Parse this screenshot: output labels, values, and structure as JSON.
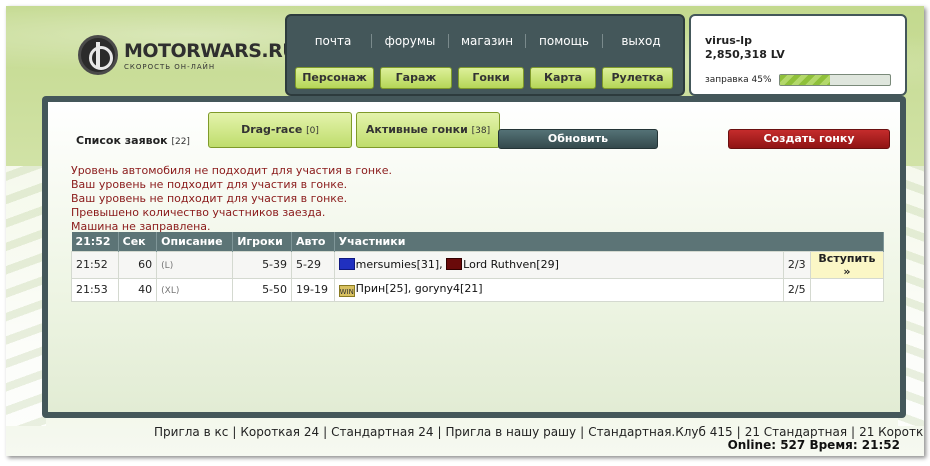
{
  "logo": {
    "title": "MOTORWARS.RU",
    "subtitle": "СКОРОСТЬ ОН-ЛАЙН"
  },
  "nav": {
    "links": [
      "почта",
      "форумы",
      "магазин",
      "помощь",
      "выход"
    ],
    "buttons": [
      "Персонаж",
      "Гараж",
      "Гонки",
      "Карта",
      "Рулетка"
    ]
  },
  "user": {
    "name": "virus-lp",
    "money": "2,850,318 LV",
    "fuel_label": "заправка 45%",
    "fuel_percent": 45
  },
  "race_list": {
    "title": "Список заявок",
    "count": "[22]",
    "tab_drag": "Drag-race",
    "tab_drag_count": "[0]",
    "tab_active": "Активные гонки",
    "tab_active_count": "[38]",
    "refresh": "Обновить",
    "create": "Создать гонку"
  },
  "messages": [
    "Уровень автомобиля не подходит для участия в гонке.",
    "Ваш уровень не подходит для участия в гонке.",
    "Ваш уровень не подходит для участия в гонке.",
    "Превышено количество участников заезда.",
    "Машина не заправлена."
  ],
  "table": {
    "headers": [
      "21:52",
      "Сек",
      "Описание",
      "Игроки",
      "Авто",
      "Участники"
    ],
    "rows": [
      {
        "time": "21:52",
        "sec": "60",
        "desc": "(L)",
        "players": "5-39",
        "auto": "5-29",
        "participants": [
          {
            "clan": "",
            "name": "mersumies[31]"
          },
          {
            "clan": "",
            "name": "Lord Ruthven[29]"
          }
        ],
        "sep": ",",
        "count": "2/3",
        "action": "Вступить »"
      },
      {
        "time": "21:53",
        "sec": "40",
        "desc": "(XL)",
        "players": "5-50",
        "auto": "19-19",
        "participants": [
          {
            "clan": "WIN",
            "name": "Прин[25]"
          },
          {
            "clan": "",
            "name": "goryny4[21]"
          }
        ],
        "sep": ",",
        "count": "2/5",
        "action": ""
      }
    ]
  },
  "footer": {
    "links": [
      "Пригла в кс",
      "Короткая 24",
      "Стандартная 24",
      "Пригла в нашу рашу",
      "Стандартная.Клуб 415",
      "21 Стандартная",
      "21 Короткая"
    ],
    "separator": "|",
    "online": "Online: 527",
    "time": "Время: 21:52"
  },
  "colors": {
    "panel": "#44575a",
    "green_button": "#bfdd6c",
    "create_button": "#c42c2c",
    "message_text": "#8a1a1a"
  },
  "icons": [
    "motorwars-logo-icon",
    "clan-badge-blue-icon",
    "clan-badge-red-icon",
    "clan-badge-win-icon"
  ]
}
